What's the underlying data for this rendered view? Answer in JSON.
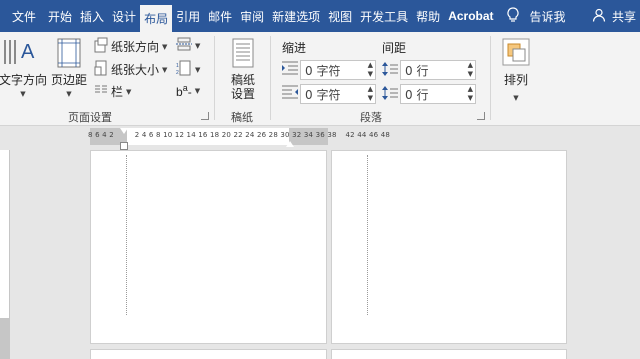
{
  "tabs": [
    "文件",
    "开始",
    "插入",
    "设计",
    "布局",
    "引用",
    "邮件",
    "审阅",
    "新建选项",
    "视图",
    "开发工具",
    "帮助",
    "Acrobat"
  ],
  "tell_me": "告诉我",
  "share": "共享",
  "ribbon": {
    "page_setup": {
      "text_direction": "文字方向",
      "margins": "页边距",
      "orientation": "纸张方向",
      "size": "纸张大小",
      "columns": "栏",
      "label": "页面设置"
    },
    "manuscript": {
      "button": "稿纸设置",
      "label": "稿纸"
    },
    "paragraph": {
      "indent_label": "缩进",
      "spacing_label": "间距",
      "indent_left": "0 字符",
      "indent_right": "0 字符",
      "spacing_before": "0 行",
      "spacing_after": "0 行",
      "label": "段落"
    },
    "arrange": {
      "button": "排列"
    }
  },
  "ruler": {
    "left_numbers": "8  6  4  2",
    "right_numbers": "2  4  6  8  10 12 14 16 18 20 22 24 26 28 30 32 34 36 38",
    "overflow_numbers": "42 44 46 48"
  }
}
